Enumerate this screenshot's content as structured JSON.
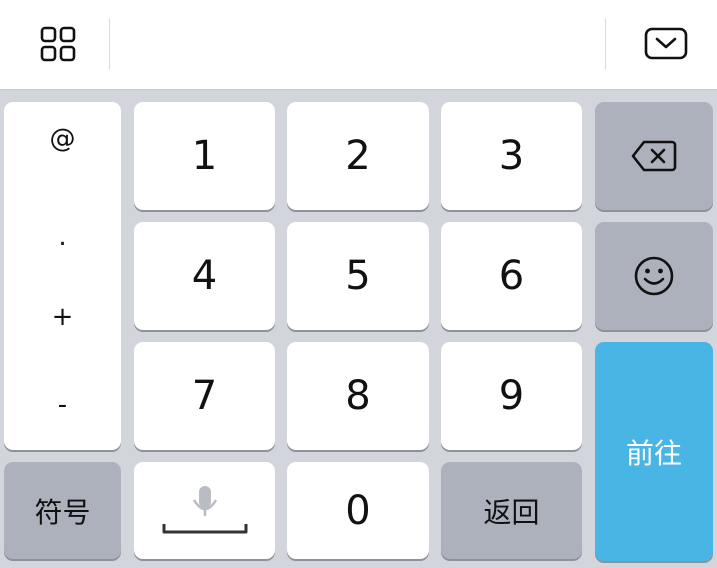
{
  "toolbar": {
    "menu_icon": "grid-icon",
    "collapse_icon": "keyboard-collapse-icon"
  },
  "symbols": [
    "@",
    ".",
    "+",
    "-"
  ],
  "keys": {
    "k1": "1",
    "k2": "2",
    "k3": "3",
    "k4": "4",
    "k5": "5",
    "k6": "6",
    "k7": "7",
    "k8": "8",
    "k9": "9",
    "k0": "0"
  },
  "labels": {
    "symbols_key": "符号",
    "back_key": "返回",
    "go_key": "前往"
  },
  "icons": {
    "delete": "backspace-icon",
    "emoji": "emoji-icon",
    "space_voice": "microphone-icon"
  },
  "colors": {
    "keyboard_bg": "#d2d5db",
    "key_bg": "#ffffff",
    "function_key_bg": "#acb1bb",
    "go_key_bg": "#48b5e4"
  }
}
